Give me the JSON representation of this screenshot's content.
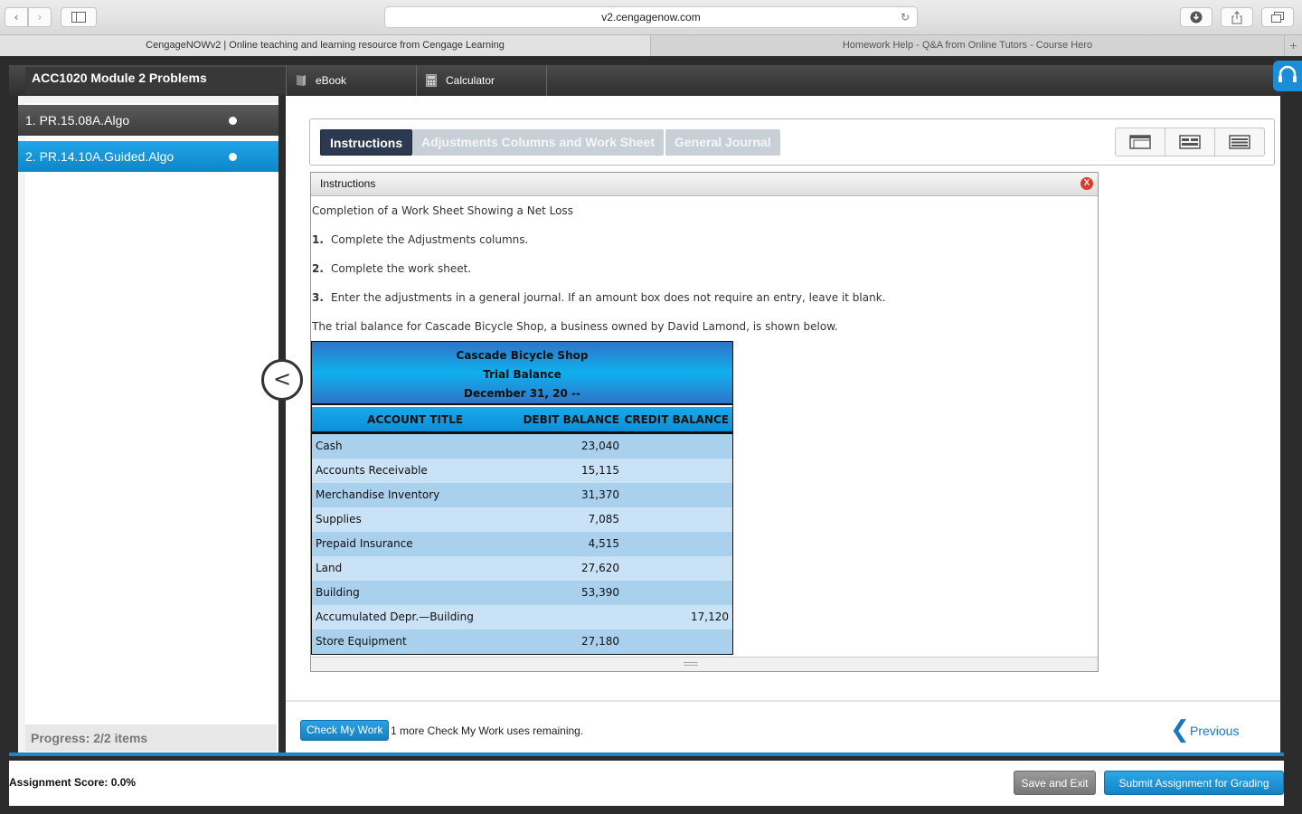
{
  "browser": {
    "url": "v2.cengagenow.com",
    "tabs": [
      "CengageNOWv2 | Online teaching and learning resource from Cengage Learning",
      "Homework Help - Q&A from Online Tutors - Course Hero"
    ]
  },
  "header": {
    "module_title": "ACC1020 Module 2 Problems",
    "tools": [
      "eBook",
      "Calculator"
    ]
  },
  "sidebar": {
    "problems": [
      "1. PR.15.08A.Algo",
      "2. PR.14.10A.Guided.Algo"
    ],
    "progress": "Progress:  2/2 items"
  },
  "main": {
    "tabs": [
      "Instructions",
      "Adjustments Columns and Work Sheet",
      "General Journal"
    ],
    "instructions": {
      "header": "Instructions",
      "title": "Completion of a Work Sheet Showing a Net Loss",
      "steps": [
        {
          "num": "1.",
          "text": "Complete the Adjustments columns."
        },
        {
          "num": "2.",
          "text": "Complete the work sheet."
        },
        {
          "num": "3.",
          "text": "Enter the adjustments in a general journal. If an amount box does not require an entry, leave it blank."
        }
      ],
      "intro": "The trial balance for Cascade Bicycle Shop, a business owned by David Lamond, is shown below."
    },
    "trial_balance": {
      "company": "Cascade Bicycle Shop",
      "statement": "Trial Balance",
      "date": "December 31, 20 --",
      "columns": [
        "ACCOUNT TITLE",
        "DEBIT BALANCE",
        "CREDIT BALANCE"
      ],
      "rows": [
        {
          "account": "Cash",
          "debit": "23,040",
          "credit": ""
        },
        {
          "account": "Accounts Receivable",
          "debit": "15,115",
          "credit": ""
        },
        {
          "account": "Merchandise Inventory",
          "debit": "31,370",
          "credit": ""
        },
        {
          "account": "Supplies",
          "debit": "7,085",
          "credit": ""
        },
        {
          "account": "Prepaid Insurance",
          "debit": "4,515",
          "credit": ""
        },
        {
          "account": "Land",
          "debit": "27,620",
          "credit": ""
        },
        {
          "account": "Building",
          "debit": "53,390",
          "credit": ""
        },
        {
          "account": "Accumulated Depr.—Building",
          "debit": "",
          "credit": "17,120"
        },
        {
          "account": "Store Equipment",
          "debit": "27,180",
          "credit": ""
        }
      ]
    }
  },
  "actions": {
    "check_label": "Check My Work",
    "check_remaining": "1 more Check My Work uses remaining.",
    "previous_label": "Previous"
  },
  "footer": {
    "score": "Assignment Score: 0.0%",
    "save_label": "Save and Exit",
    "submit_label": "Submit Assignment for Grading"
  }
}
